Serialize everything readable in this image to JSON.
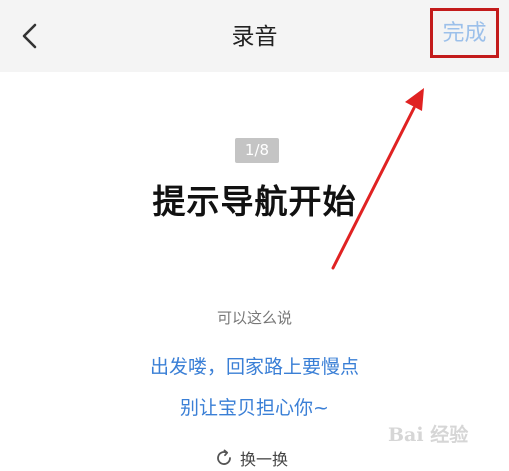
{
  "header": {
    "title": "录音",
    "done_label": "完成"
  },
  "prompt": {
    "page_indicator": "1/8",
    "title": "提示导航开始"
  },
  "hint": {
    "label": "可以这么说",
    "lines": [
      "出发喽，回家路上要慢点",
      "别让宝贝担心你~"
    ]
  },
  "refresh_label": "换一换",
  "watermark_text": "Bai 经验",
  "colors": {
    "header_bg": "#f4f4f4",
    "accent_blue": "#3a7fd6",
    "done_text": "#9cc0ea",
    "highlight_red": "#c31b1b"
  }
}
